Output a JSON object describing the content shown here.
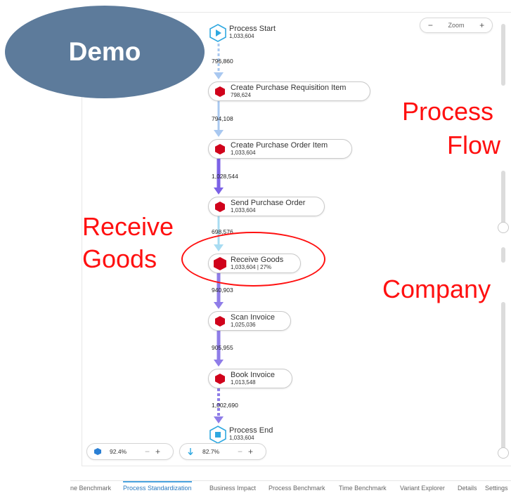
{
  "watermark": "Demo",
  "zoom": {
    "minus": "−",
    "label": "Zoom",
    "plus": "+"
  },
  "annotations": {
    "process_flow_line1": "Process",
    "process_flow_line2": "Flow",
    "receive_goods_line1": "Receive",
    "receive_goods_line2": "Goods",
    "company": "Company"
  },
  "process": {
    "start": {
      "label": "Process Start",
      "count": "1,033,604"
    },
    "end": {
      "label": "Process End",
      "count": "1,033,604"
    },
    "activities": [
      {
        "label": "Create Purchase Requisition Item",
        "count": "798,624"
      },
      {
        "label": "Create Purchase Order Item",
        "count": "1,033,604"
      },
      {
        "label": "Send Purchase Order",
        "count": "1,033,604"
      },
      {
        "label": "Receive Goods",
        "count": "1,033,604 | 27%"
      },
      {
        "label": "Scan Invoice",
        "count": "1,025,036"
      },
      {
        "label": "Book Invoice",
        "count": "1,013,548"
      }
    ],
    "edges": [
      "796,860",
      "794,108",
      "1,028,544",
      "698,576",
      "940,903",
      "905,955",
      "1,002,690"
    ],
    "edge_colors": [
      "#a9c8f0",
      "#a9c8f0",
      "#7c62e6",
      "#a8dcf2",
      "#8f7de8",
      "#8f7de8",
      "#8f7de8"
    ]
  },
  "sliders": {
    "activities": {
      "value": "92.4%",
      "minus": "−",
      "plus": "+"
    },
    "connections": {
      "value": "82.7%",
      "minus": "−",
      "plus": "+"
    }
  },
  "tabs": [
    {
      "label": "ne Benchmark",
      "active": false
    },
    {
      "label": "Process Standardization",
      "active": true
    },
    {
      "label": "Business Impact",
      "active": false
    },
    {
      "label": "Process Benchmark",
      "active": false
    },
    {
      "label": "Time Benchmark",
      "active": false
    },
    {
      "label": "Variant Explorer",
      "active": false
    },
    {
      "label": "Details",
      "active": false
    },
    {
      "label": "Settings",
      "active": false
    }
  ],
  "colors": {
    "activity_hex": "#d0021b",
    "start_end": "#2fa8e0",
    "annotation": "#ff1010",
    "watermark_bg": "#5d7b9b",
    "active_tab": "#2a7abf"
  }
}
